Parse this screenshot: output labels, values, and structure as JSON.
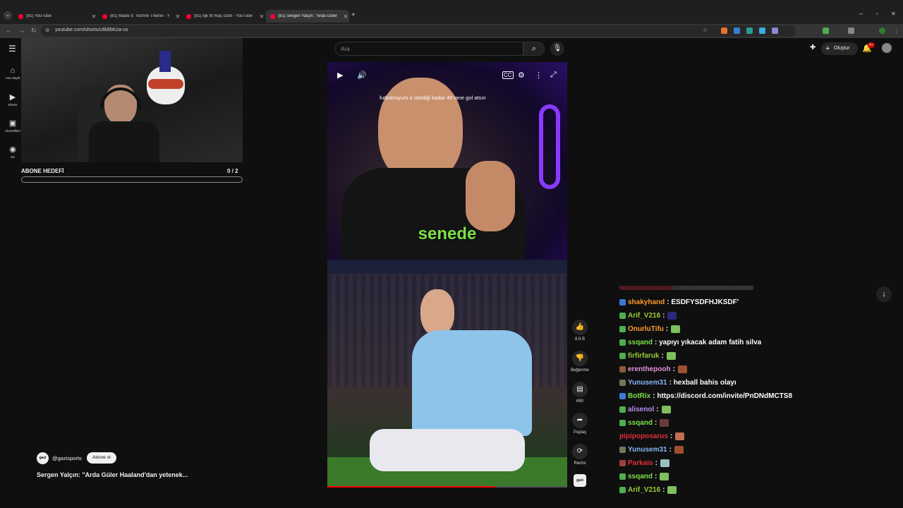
{
  "browser": {
    "tabs": [
      {
        "label": "(81) YouTube",
        "active": false
      },
      {
        "label": "(81) Blade II: Techno Theme - Y",
        "active": false
      },
      {
        "label": "(81) bjk fb maç özeti - YouTube",
        "active": false
      },
      {
        "label": "(81) Sergen Yalçın: \"Arda Güler",
        "active": true
      }
    ],
    "url": "youtube.com/shorts/c8k8bKza-us"
  },
  "stream": {
    "goal_label": "ABONE HEDEFİ",
    "goal_count": "0   / 2",
    "goal_progress": 0
  },
  "sidebar": {
    "items": [
      {
        "label": "Ana Sayfa",
        "icon": "home-icon"
      },
      {
        "label": "Shorts",
        "icon": "shorts-icon"
      },
      {
        "label": "Abonelikler",
        "icon": "subscriptions-icon"
      },
      {
        "label": "Siz",
        "icon": "you-icon"
      }
    ]
  },
  "header": {
    "search_placeholder": "Ara",
    "create_label": "Oluştur",
    "notif_badge": "9+"
  },
  "video": {
    "caption_top": "futbolcuyum o istediği kadar 40 tane gol atsın",
    "caption_big": "senede",
    "progress": 0.7
  },
  "actions": {
    "like_count": "8,9 B",
    "dislike_label": "Beğenme",
    "comments_count": "690",
    "share_label": "Paylaş",
    "remix_label": "Remix",
    "channel_mini": "gazi"
  },
  "channel": {
    "avatar_text": "gazi",
    "name": "@gazisports",
    "subscribe_label": "Abone ol",
    "title": "Sergen Yalçın: \"Arda Güler Haaland'dan yetenek..."
  },
  "chat": {
    "messages": [
      {
        "user": "shakyhand",
        "text": ": ESDFYSDFHJKSDF'",
        "color": "#ff9b2f",
        "badge": "#3a7bd5",
        "emote": ""
      },
      {
        "user": "Arif_V216",
        "text": ":",
        "color": "#9acd32",
        "badge": "#4caf50",
        "emote": "#2a2a7a"
      },
      {
        "user": "OnurluTifu",
        "text": ":",
        "color": "#ff9b2f",
        "badge": "#4caf50",
        "emote": "#7fbf5f"
      },
      {
        "user": "ssqand",
        "text": ": yapıyı yıkacak adam fatih silva",
        "color": "#7ce04a",
        "badge": "#4caf50",
        "emote": ""
      },
      {
        "user": "firfirfaruk",
        "text": ":",
        "color": "#9acd32",
        "badge": "#4caf50",
        "emote": "#7fbf5f"
      },
      {
        "user": "erenthepooh",
        "text": ":",
        "color": "#e58ee0",
        "badge": "#8a5a3a",
        "emote": "#a05030"
      },
      {
        "user": "Yunusem31",
        "text": ": hexball bahis olayı",
        "color": "#8ab4f8",
        "badge": "#6a7a5a",
        "emote": ""
      },
      {
        "user": "BotRix",
        "text": ": https://discord.com/invite/PnDNdMCTS8",
        "color": "#7ce04a",
        "badge": "#3a7bd5",
        "emote": ""
      },
      {
        "user": "alisenol",
        "text": ":",
        "color": "#b98ef0",
        "badge": "#4caf50",
        "emote": "#7fbf5f"
      },
      {
        "user": "ssqand",
        "text": ":",
        "color": "#7ce04a",
        "badge": "#4caf50",
        "emote": "#6a3a3a"
      },
      {
        "user": "pipipoposarus",
        "text": ":",
        "color": "#e0303a",
        "badge": "",
        "emote": "#c07050"
      },
      {
        "user": "Yunusem31",
        "text": ":",
        "color": "#8ab4f8",
        "badge": "#6a7a5a",
        "emote": "#a05030"
      },
      {
        "user": "Parkais",
        "text": ":",
        "color": "#e0303a",
        "badge": "#a04040",
        "emote": "#9ac0c0"
      },
      {
        "user": "ssqand",
        "text": ":",
        "color": "#7ce04a",
        "badge": "#4caf50",
        "emote": "#7fbf5f"
      },
      {
        "user": "Arif_V216",
        "text": ":",
        "color": "#9acd32",
        "badge": "#4caf50",
        "emote": "#7fbf5f"
      }
    ]
  }
}
